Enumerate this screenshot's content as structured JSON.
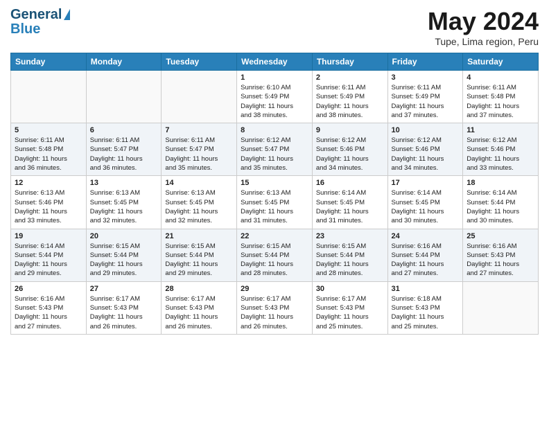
{
  "logo": {
    "line1": "General",
    "line2": "Blue"
  },
  "title": "May 2024",
  "subtitle": "Tupe, Lima region, Peru",
  "days": [
    "Sunday",
    "Monday",
    "Tuesday",
    "Wednesday",
    "Thursday",
    "Friday",
    "Saturday"
  ],
  "weeks": [
    [
      {
        "day": "",
        "info": ""
      },
      {
        "day": "",
        "info": ""
      },
      {
        "day": "",
        "info": ""
      },
      {
        "day": "1",
        "info": "Sunrise: 6:10 AM\nSunset: 5:49 PM\nDaylight: 11 hours\nand 38 minutes."
      },
      {
        "day": "2",
        "info": "Sunrise: 6:11 AM\nSunset: 5:49 PM\nDaylight: 11 hours\nand 38 minutes."
      },
      {
        "day": "3",
        "info": "Sunrise: 6:11 AM\nSunset: 5:49 PM\nDaylight: 11 hours\nand 37 minutes."
      },
      {
        "day": "4",
        "info": "Sunrise: 6:11 AM\nSunset: 5:48 PM\nDaylight: 11 hours\nand 37 minutes."
      }
    ],
    [
      {
        "day": "5",
        "info": "Sunrise: 6:11 AM\nSunset: 5:48 PM\nDaylight: 11 hours\nand 36 minutes."
      },
      {
        "day": "6",
        "info": "Sunrise: 6:11 AM\nSunset: 5:47 PM\nDaylight: 11 hours\nand 36 minutes."
      },
      {
        "day": "7",
        "info": "Sunrise: 6:11 AM\nSunset: 5:47 PM\nDaylight: 11 hours\nand 35 minutes."
      },
      {
        "day": "8",
        "info": "Sunrise: 6:12 AM\nSunset: 5:47 PM\nDaylight: 11 hours\nand 35 minutes."
      },
      {
        "day": "9",
        "info": "Sunrise: 6:12 AM\nSunset: 5:46 PM\nDaylight: 11 hours\nand 34 minutes."
      },
      {
        "day": "10",
        "info": "Sunrise: 6:12 AM\nSunset: 5:46 PM\nDaylight: 11 hours\nand 34 minutes."
      },
      {
        "day": "11",
        "info": "Sunrise: 6:12 AM\nSunset: 5:46 PM\nDaylight: 11 hours\nand 33 minutes."
      }
    ],
    [
      {
        "day": "12",
        "info": "Sunrise: 6:13 AM\nSunset: 5:46 PM\nDaylight: 11 hours\nand 33 minutes."
      },
      {
        "day": "13",
        "info": "Sunrise: 6:13 AM\nSunset: 5:45 PM\nDaylight: 11 hours\nand 32 minutes."
      },
      {
        "day": "14",
        "info": "Sunrise: 6:13 AM\nSunset: 5:45 PM\nDaylight: 11 hours\nand 32 minutes."
      },
      {
        "day": "15",
        "info": "Sunrise: 6:13 AM\nSunset: 5:45 PM\nDaylight: 11 hours\nand 31 minutes."
      },
      {
        "day": "16",
        "info": "Sunrise: 6:14 AM\nSunset: 5:45 PM\nDaylight: 11 hours\nand 31 minutes."
      },
      {
        "day": "17",
        "info": "Sunrise: 6:14 AM\nSunset: 5:45 PM\nDaylight: 11 hours\nand 30 minutes."
      },
      {
        "day": "18",
        "info": "Sunrise: 6:14 AM\nSunset: 5:44 PM\nDaylight: 11 hours\nand 30 minutes."
      }
    ],
    [
      {
        "day": "19",
        "info": "Sunrise: 6:14 AM\nSunset: 5:44 PM\nDaylight: 11 hours\nand 29 minutes."
      },
      {
        "day": "20",
        "info": "Sunrise: 6:15 AM\nSunset: 5:44 PM\nDaylight: 11 hours\nand 29 minutes."
      },
      {
        "day": "21",
        "info": "Sunrise: 6:15 AM\nSunset: 5:44 PM\nDaylight: 11 hours\nand 29 minutes."
      },
      {
        "day": "22",
        "info": "Sunrise: 6:15 AM\nSunset: 5:44 PM\nDaylight: 11 hours\nand 28 minutes."
      },
      {
        "day": "23",
        "info": "Sunrise: 6:15 AM\nSunset: 5:44 PM\nDaylight: 11 hours\nand 28 minutes."
      },
      {
        "day": "24",
        "info": "Sunrise: 6:16 AM\nSunset: 5:44 PM\nDaylight: 11 hours\nand 27 minutes."
      },
      {
        "day": "25",
        "info": "Sunrise: 6:16 AM\nSunset: 5:43 PM\nDaylight: 11 hours\nand 27 minutes."
      }
    ],
    [
      {
        "day": "26",
        "info": "Sunrise: 6:16 AM\nSunset: 5:43 PM\nDaylight: 11 hours\nand 27 minutes."
      },
      {
        "day": "27",
        "info": "Sunrise: 6:17 AM\nSunset: 5:43 PM\nDaylight: 11 hours\nand 26 minutes."
      },
      {
        "day": "28",
        "info": "Sunrise: 6:17 AM\nSunset: 5:43 PM\nDaylight: 11 hours\nand 26 minutes."
      },
      {
        "day": "29",
        "info": "Sunrise: 6:17 AM\nSunset: 5:43 PM\nDaylight: 11 hours\nand 26 minutes."
      },
      {
        "day": "30",
        "info": "Sunrise: 6:17 AM\nSunset: 5:43 PM\nDaylight: 11 hours\nand 25 minutes."
      },
      {
        "day": "31",
        "info": "Sunrise: 6:18 AM\nSunset: 5:43 PM\nDaylight: 11 hours\nand 25 minutes."
      },
      {
        "day": "",
        "info": ""
      }
    ]
  ]
}
